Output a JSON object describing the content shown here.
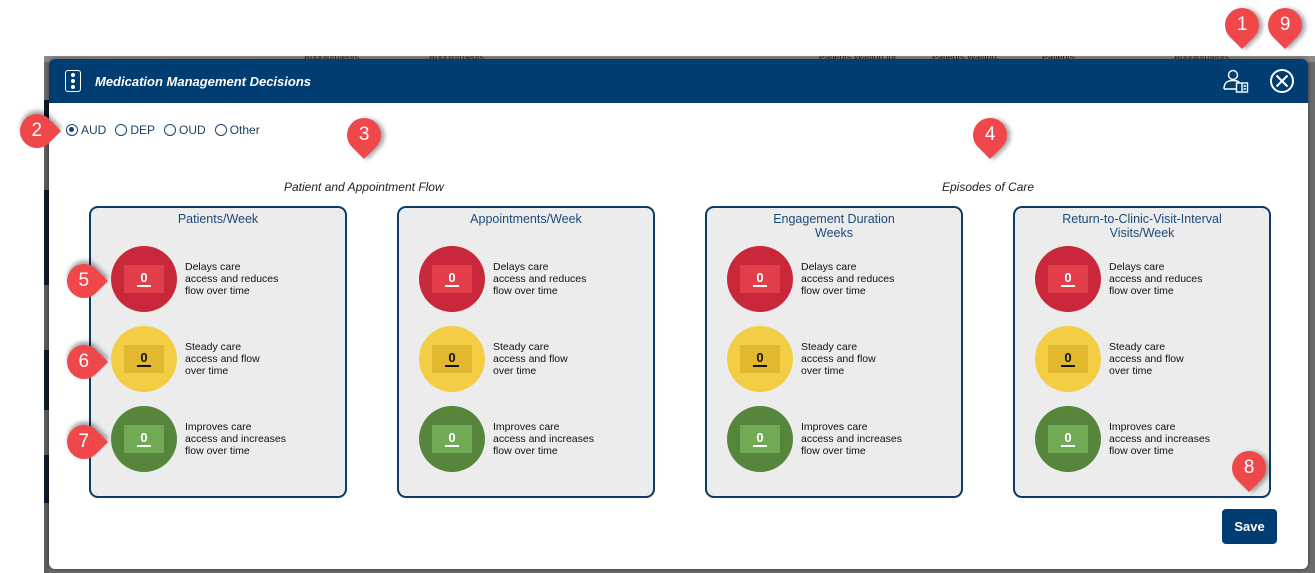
{
  "background_app": {
    "column_headers": [
      "Appointments",
      "Appointments",
      "Patients Waiting for",
      "Patients Waiting",
      "Patients",
      "Appointments"
    ]
  },
  "modal": {
    "title": "Medication Management Decisions",
    "header_icons": [
      "provider-card-icon",
      "close-circle-icon"
    ]
  },
  "conditions": {
    "selected": "AUD",
    "options": [
      {
        "label": "AUD",
        "checked": true
      },
      {
        "label": "DEP",
        "checked": false
      },
      {
        "label": "OUD",
        "checked": false
      },
      {
        "label": "Other",
        "checked": false
      }
    ]
  },
  "sections": [
    {
      "title": "Patient and Appointment Flow"
    },
    {
      "title": "Episodes of Care"
    }
  ],
  "cards": [
    {
      "title_line1": "Patients/Week",
      "title_line2": "",
      "options": [
        {
          "value": "0",
          "label1": "Delays care",
          "label2": "access and reduces",
          "label3": "flow over time"
        },
        {
          "value": "0",
          "label1": "Steady care",
          "label2": "access and flow",
          "label3": "over time"
        },
        {
          "value": "0",
          "label1": "Improves care",
          "label2": "access and increases",
          "label3": "flow over time"
        }
      ]
    },
    {
      "title_line1": "Appointments/Week",
      "title_line2": "",
      "options": [
        {
          "value": "0",
          "label1": "Delays care",
          "label2": "access and reduces",
          "label3": "flow over time"
        },
        {
          "value": "0",
          "label1": "Steady care",
          "label2": "access and flow",
          "label3": "over time"
        },
        {
          "value": "0",
          "label1": "Improves care",
          "label2": "access and increases",
          "label3": "flow over time"
        }
      ]
    },
    {
      "title_line1": "Engagement Duration",
      "title_line2": "Weeks",
      "options": [
        {
          "value": "0",
          "label1": "Delays care",
          "label2": "access and reduces",
          "label3": "flow over time"
        },
        {
          "value": "0",
          "label1": "Steady care",
          "label2": "access and flow",
          "label3": "over time"
        },
        {
          "value": "0",
          "label1": "Improves care",
          "label2": "access and increases",
          "label3": "flow over time"
        }
      ]
    },
    {
      "title_line1": "Return-to-Clinic-Visit-Interval",
      "title_line2": "Visits/Week",
      "options": [
        {
          "value": "0",
          "label1": "Delays care",
          "label2": "access and reduces",
          "label3": "flow over time"
        },
        {
          "value": "0",
          "label1": "Steady care",
          "label2": "access and flow",
          "label3": "over time"
        },
        {
          "value": "0",
          "label1": "Improves care",
          "label2": "access and increases",
          "label3": "flow over time"
        }
      ]
    }
  ],
  "save_label": "Save",
  "callouts": [
    "1",
    "2",
    "3",
    "4",
    "5",
    "6",
    "7",
    "8",
    "9"
  ],
  "colors": {
    "header": "#003d73",
    "red": "#c8283a",
    "yellow": "#f3ce45",
    "green": "#56863b",
    "callout": "#f0474b"
  }
}
